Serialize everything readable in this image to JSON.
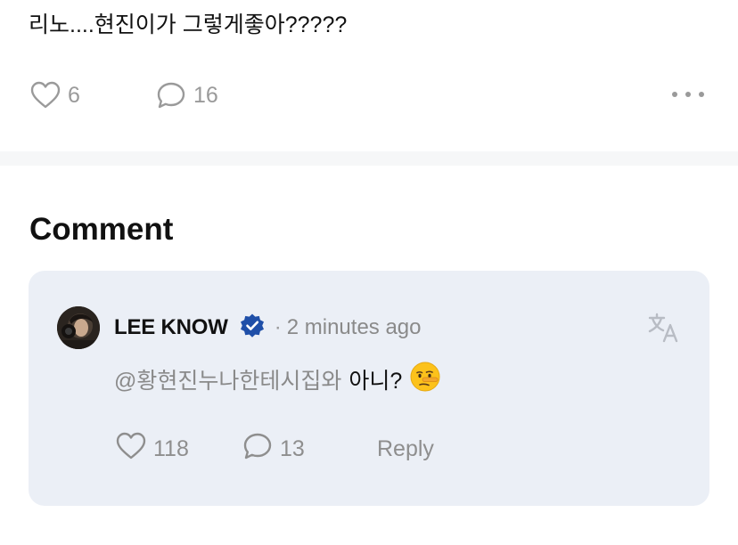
{
  "post": {
    "text": "리노....현진이가 그렇게좋아?????",
    "likes": "6",
    "comments": "16"
  },
  "comments_section": {
    "title": "Comment"
  },
  "comment": {
    "author": "LEE KNOW",
    "separator": "·",
    "time": "2 minutes ago",
    "mention": "@황현진누나한테시집와",
    "text": "아니?",
    "emoji": "🤥",
    "likes": "118",
    "replies": "13",
    "reply_label": "Reply"
  },
  "colors": {
    "background": "#ffffff",
    "card": "#ebeff6",
    "muted_text": "#8e8e8e",
    "verified_badge": "#1f4fa8"
  },
  "icons": {
    "like": "heart-icon",
    "comment": "speech-bubble-icon",
    "more": "more-dots-icon",
    "verified": "verified-badge-icon",
    "translate": "translate-icon"
  }
}
